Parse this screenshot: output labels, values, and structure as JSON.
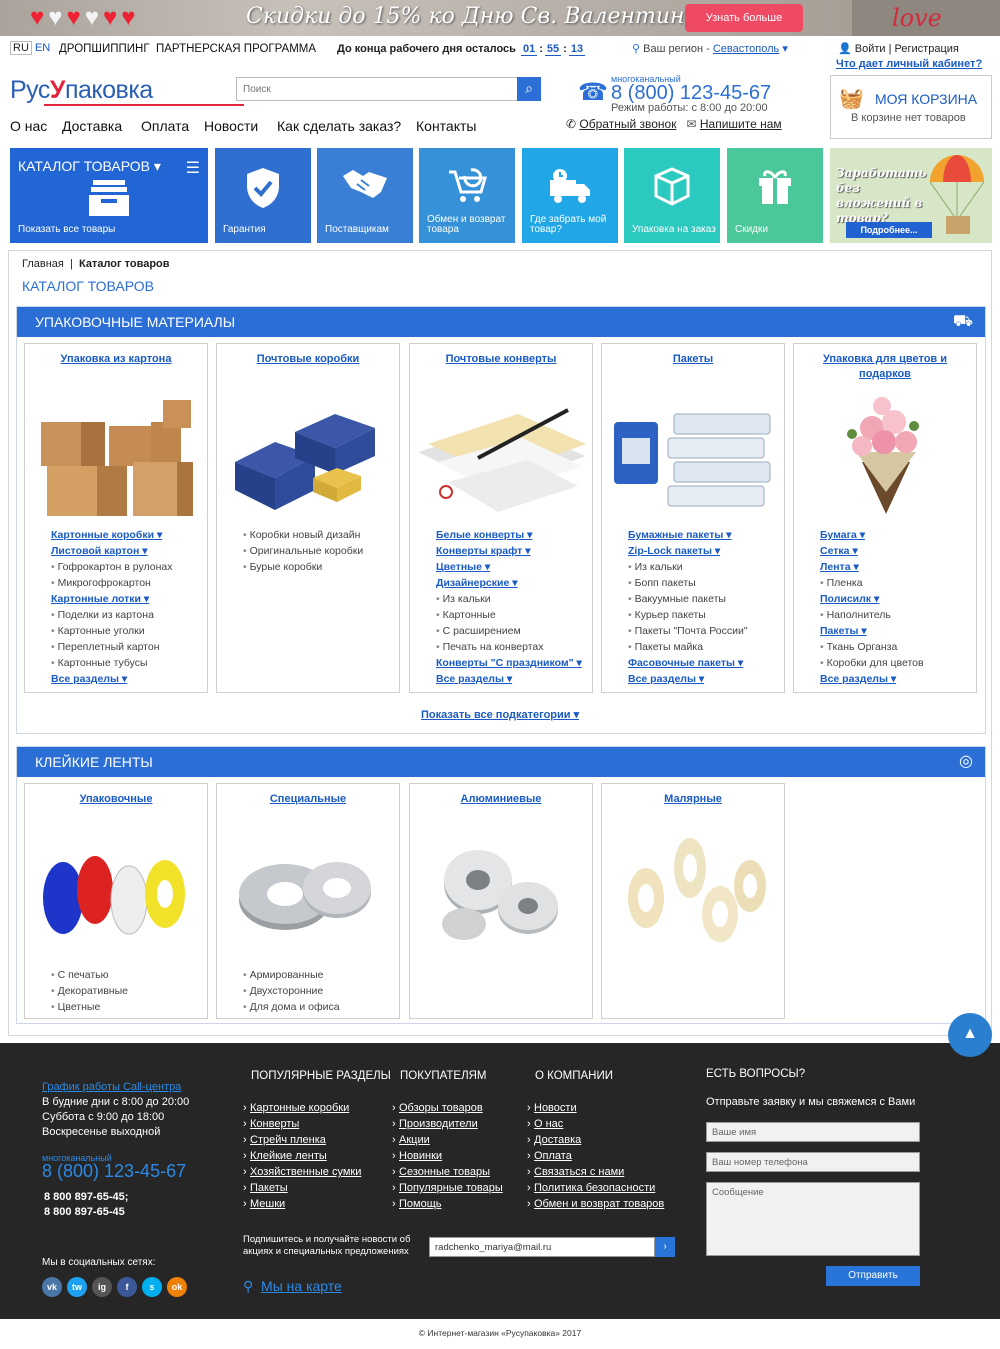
{
  "banner": {
    "title": "Скидки до 15% ко Дню Св. Валентина!",
    "button": "Узнать больше",
    "love": "love"
  },
  "topbar": {
    "lang_ru": "RU",
    "lang_en": "EN",
    "dropship": "ДРОПШИППИНГ",
    "partner": "ПАРТНЕРСКАЯ ПРОГРАММА",
    "timer_label": "До конца рабочего дня осталось",
    "timer_h": "01",
    "timer_m": "55",
    "timer_s": "13",
    "region_label": "Ваш регион -",
    "region_city": "Севастополь",
    "login": "Войти",
    "register": "Регистрация",
    "cabinet": "Что дает личный кабинет?"
  },
  "header": {
    "logo_a": "Рус",
    "logo_b": "У",
    "logo_c": "паковка",
    "search_placeholder": "Поиск",
    "phone_label": "многоканальный",
    "phone": "8 (800) 123-45-67",
    "hours": "Режим работы: с 8:00 до 20:00",
    "callback": "Обратный звонок",
    "write": "Напишите нам",
    "cart_title": "МОЯ КОРЗИНА",
    "cart_status": "В корзине нет товаров"
  },
  "nav": [
    "О нас",
    "Доставка",
    "Оплата",
    "Новости",
    "Как сделать заказ?",
    "Контакты"
  ],
  "tiles": {
    "catalog_title": "КАТАЛОГ ТОВАРОВ",
    "catalog_sub": "Показать все товары",
    "items": [
      {
        "label": "Гарантия",
        "color": "#2e6fd0"
      },
      {
        "label": "Поставщикам",
        "color": "#3a7fd6"
      },
      {
        "label": "Обмен и возврат товара",
        "color": "#3592d8"
      },
      {
        "label": "Где забрать мой товар?",
        "color": "#21a7e8"
      },
      {
        "label": "Упаковка на заказ",
        "color": "#2bc9c0"
      },
      {
        "label": "Скидки",
        "color": "#4bc89a"
      }
    ],
    "promo_text": "Заработать без вложений в товар?",
    "promo_button": "Подробнее..."
  },
  "breadcrumb": {
    "home": "Главная",
    "current": "Каталог товаров"
  },
  "page_title": "КАТАЛОГ ТОВАРОВ",
  "section1": {
    "title": "УПАКОВОЧНЫЕ МАТЕРИАЛЫ",
    "show_all": "Показать все подкатегории",
    "cards": [
      {
        "title": "Упаковка из картона",
        "items": [
          {
            "t": "Картонные коробки",
            "link": true
          },
          {
            "t": "Листовой картон",
            "link": true
          },
          {
            "t": "Гофрокартон в рулонах",
            "link": false
          },
          {
            "t": "Микрогофрокартон",
            "link": false
          },
          {
            "t": "Картонные лотки",
            "link": true
          },
          {
            "t": "Поделки из картона",
            "link": false
          },
          {
            "t": "Картонные уголки",
            "link": false
          },
          {
            "t": "Переплетный картон",
            "link": false
          },
          {
            "t": "Картонные тубусы",
            "link": false
          },
          {
            "t": "Все разделы",
            "link": true
          }
        ]
      },
      {
        "title": "Почтовые коробки",
        "items": [
          {
            "t": "Коробки новый дизайн",
            "link": false
          },
          {
            "t": "Оригинальные коробки",
            "link": false
          },
          {
            "t": "Бурые коробки",
            "link": false
          }
        ]
      },
      {
        "title": "Почтовые конверты",
        "items": [
          {
            "t": "Белые конверты",
            "link": true
          },
          {
            "t": "Конверты крафт",
            "link": true
          },
          {
            "t": "Цветные",
            "link": true
          },
          {
            "t": "Дизайнерские",
            "link": true
          },
          {
            "t": "Из кальки",
            "link": false
          },
          {
            "t": "Картонные",
            "link": false
          },
          {
            "t": "С расширением",
            "link": false
          },
          {
            "t": "Печать на конвертах",
            "link": false
          },
          {
            "t": "Конверты \"С праздником\"",
            "link": true
          },
          {
            "t": "Все разделы",
            "link": true
          }
        ]
      },
      {
        "title": "Пакеты",
        "items": [
          {
            "t": "Бумажные пакеты",
            "link": true
          },
          {
            "t": "Zip-Lock пакеты",
            "link": true
          },
          {
            "t": "Из кальки",
            "link": false
          },
          {
            "t": "Бопп пакеты",
            "link": false
          },
          {
            "t": "Вакуумные пакеты",
            "link": false
          },
          {
            "t": "Курьер пакеты",
            "link": false
          },
          {
            "t": "Пакеты \"Почта России\"",
            "link": false
          },
          {
            "t": "Пакеты майка",
            "link": false
          },
          {
            "t": "Фасовочные пакеты",
            "link": true
          },
          {
            "t": "Все разделы",
            "link": true
          }
        ]
      },
      {
        "title": "Упаковка для цветов и подарков",
        "items": [
          {
            "t": "Бумага",
            "link": true
          },
          {
            "t": "Сетка",
            "link": true
          },
          {
            "t": "Лента",
            "link": true
          },
          {
            "t": "Пленка",
            "link": false
          },
          {
            "t": "Полисилк",
            "link": true
          },
          {
            "t": "Наполнитель",
            "link": false
          },
          {
            "t": "Пакеты",
            "link": true
          },
          {
            "t": "Ткань Органза",
            "link": false
          },
          {
            "t": "Коробки для цветов",
            "link": false
          },
          {
            "t": "Все разделы",
            "link": true
          }
        ]
      }
    ]
  },
  "section2": {
    "title": "КЛЕЙКИЕ ЛЕНТЫ",
    "cards": [
      {
        "title": "Упаковочные",
        "items": [
          {
            "t": "С печатью",
            "link": false
          },
          {
            "t": "Декоративные",
            "link": false
          },
          {
            "t": "Цветные",
            "link": false
          }
        ]
      },
      {
        "title": "Специальные",
        "items": [
          {
            "t": "Армированные",
            "link": false
          },
          {
            "t": "Двухсторонние",
            "link": false
          },
          {
            "t": "Для дома и офиса",
            "link": false
          }
        ]
      },
      {
        "title": "Алюминиевые",
        "items": []
      },
      {
        "title": "Малярные",
        "items": []
      }
    ]
  },
  "footer": {
    "callcenter_title": "График работы Call-центра",
    "weekdays": "В будние дни с 8:00 до 20:00",
    "saturday": "Суббота с 9:00 до 18:00",
    "sunday": "Воскресенье выходной",
    "phone_label": "многоканальный",
    "phone": "8 (800) 123-45-67",
    "phone2": "8 800 897-65-45;",
    "phone3": "8 800 897-65-45",
    "social_title": "Мы в социальных сетях:",
    "social": [
      {
        "n": "vk",
        "c": "#4a76a8"
      },
      {
        "n": "tw",
        "c": "#1da1f2"
      },
      {
        "n": "ig",
        "c": "#555"
      },
      {
        "n": "f",
        "c": "#3b5998"
      },
      {
        "n": "s",
        "c": "#00aff0"
      },
      {
        "n": "ok",
        "c": "#ee8208"
      }
    ],
    "col1_title": "ПОПУЛЯРНЫЕ РАЗДЕЛЫ",
    "col1": [
      "Картонные коробки",
      "Конверты",
      "Стрейч пленка",
      "Клейкие ленты",
      "Хозяйственные сумки",
      "Пакеты",
      "Мешки"
    ],
    "col2_title": "ПОКУПАТЕЛЯМ",
    "col2": [
      "Обзоры товаров",
      "Производители",
      "Акции",
      "Новинки",
      "Сезонные товары",
      "Популярные товары",
      "Помощь"
    ],
    "col3_title": "О КОМПАНИИ",
    "col3": [
      "Новости",
      "О нас",
      "Доставка",
      "Оплата",
      "Связаться с нами",
      "Политика безопасности",
      "Обмен и возврат товаров"
    ],
    "subscribe_text": "Подпишитесь и получайте новости об акциях и специальных предложениях",
    "subscribe_value": "radchenko_mariya@mail.ru",
    "map": "Мы на карте",
    "q_title": "ЕСТЬ ВОПРОСЫ?",
    "q_text": "Отправьте заявку и мы свяжемся с Вами",
    "name_ph": "Ваше имя",
    "tel_ph": "Ваш номер телефона",
    "msg_ph": "Сообщение",
    "send": "Отправить",
    "copyright": "© Интернет-магазин «Русупаковка» 2017"
  },
  "colors": {
    "accent": "#2b6fd6",
    "brand_red": "#e2253c",
    "footer_bg": "#262626"
  }
}
